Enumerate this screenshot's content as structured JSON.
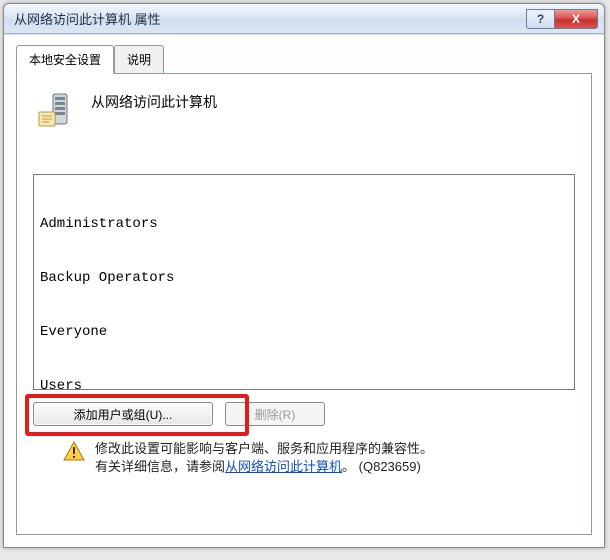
{
  "window": {
    "title": "从网络访问此计算机 属性",
    "help_symbol": "?",
    "close_symbol": "X"
  },
  "tabs": {
    "active": "本地安全设置",
    "inactive": "说明"
  },
  "panel": {
    "heading": "从网络访问此计算机",
    "list": [
      "Administrators",
      "Backup Operators",
      "Everyone",
      "Users"
    ],
    "add_button": "添加用户或组(U)...",
    "remove_button": "删除(R)"
  },
  "info": {
    "line1": "修改此设置可能影响与客户端、服务和应用程序的兼容性。",
    "line2_prefix": "有关详细信息，请参阅",
    "link_text": "从网络访问此计算机",
    "line2_suffix": "。  (Q823659)"
  }
}
